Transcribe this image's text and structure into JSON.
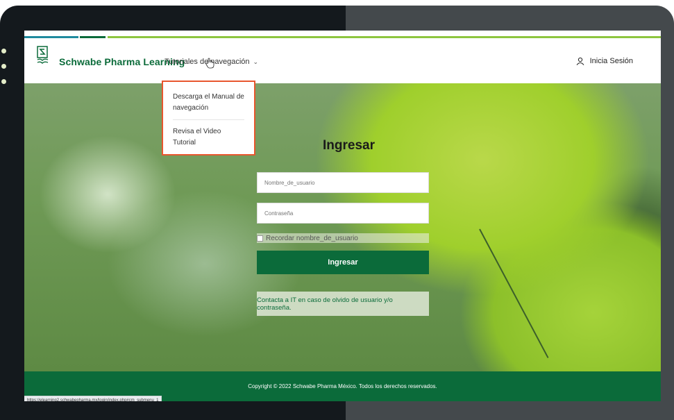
{
  "header": {
    "brand": "Schwabe Pharma Learning",
    "nav_menu_label": "Tutoriales de navegación",
    "login_label": "Inicia Sesión"
  },
  "dropdown": {
    "items": [
      {
        "label": "Descarga el Manual de navegación"
      },
      {
        "label": "Revisa el Video Tutorial"
      }
    ]
  },
  "login_form": {
    "title": "Ingresar",
    "username_placeholder": "Nombre_de_usuario",
    "password_placeholder": "Contraseña",
    "remember_label": "Recordar nombre_de_usuario",
    "submit_label": "Ingresar",
    "help_text": "Contacta a IT en caso de olvido de usuario y/o contraseña."
  },
  "footer": {
    "copyright": "Copyright © 2022 Schwabe Pharma México. Todos los derechos reservados."
  },
  "status_bar": {
    "url": "https://elearning2.schwabepharma.mx/login/index.php#cm_submenu_1"
  },
  "colors": {
    "brand_green": "#0b6b3a",
    "accent_lime": "#8dc63f",
    "highlight_orange": "#e8562e"
  }
}
